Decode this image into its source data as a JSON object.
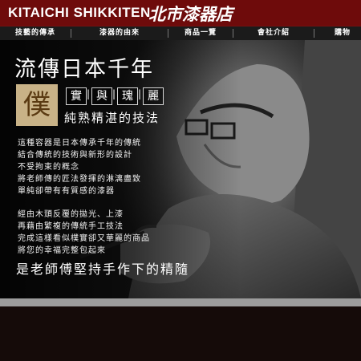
{
  "header": {
    "brand_en": "KITAICHI SHIKKITEN",
    "brand_jp": "北市漆器店"
  },
  "nav": {
    "items": [
      {
        "label": "技藝的傳承"
      },
      {
        "label": "漆器的由來"
      },
      {
        "label": "商品一覽"
      },
      {
        "label": "會社介紹"
      },
      {
        "label": "購物"
      }
    ]
  },
  "hero": {
    "title": "流傳日本千年",
    "seal": "僕",
    "tags": [
      "實",
      "與",
      "瑰",
      "麗"
    ],
    "subtitle": "純熟精湛的技法",
    "paragraph1": [
      "這種容器是日本傳承千年的傳統",
      "結合傳統的技術與新形的設計",
      "不受拘束的概念",
      "將老師傳的匠法發揮的淋漓盡致",
      "單純卻帶有有質感的漆器"
    ],
    "paragraph2": [
      "經由木頭反覆的拋光、上漆",
      "再藉由繁複的傳統手工技法",
      "完成這樣看似樸實卻又華麗的商品",
      "將您的幸福完整包起來"
    ],
    "slogan": "是老師傅堅持手作下的精隨"
  }
}
